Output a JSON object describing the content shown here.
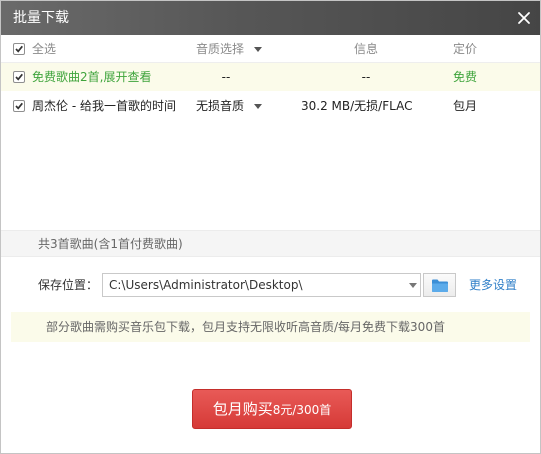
{
  "window": {
    "title": "批量下载"
  },
  "header": {
    "select_all": "全选",
    "quality": "音质选择",
    "info": "信息",
    "price": "定价"
  },
  "rows": [
    {
      "name": "免费歌曲2首,展开查看",
      "quality": "--",
      "info": "--",
      "price": "免费",
      "checked": true
    },
    {
      "name": "周杰伦 - 给我一首歌的时间",
      "quality": "无损音质",
      "info": "30.2 MB/无损/FLAC",
      "price": "包月",
      "checked": true
    }
  ],
  "summary": "共3首歌曲(含1首付费歌曲)",
  "save": {
    "label": "保存位置：",
    "path": "C:\\Users\\Administrator\\Desktop\\",
    "more_settings": "更多设置"
  },
  "notice": "部分歌曲需购买音乐包下载，包月支持无限收听高音质/每月免费下载300首",
  "buy_button": {
    "main": "包月购买",
    "sub": "8元/300首"
  },
  "icons": {
    "close": "close-icon",
    "folder": "folder-icon",
    "dropdown": "chevron-down-icon",
    "check": "check-icon"
  },
  "colors": {
    "title_bar": "#565656",
    "free_text": "#3fa43c",
    "link": "#2f7fc8",
    "buy_button": "#d63a37",
    "highlight_bg": "#fbfbea"
  }
}
